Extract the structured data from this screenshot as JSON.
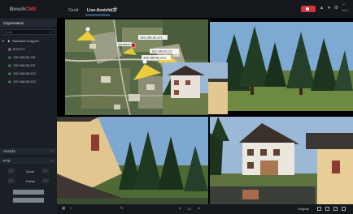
{
  "app": {
    "logo_part1": "Bosch",
    "logo_part2": "CMS",
    "logo_superscript": "®"
  },
  "tabs": [
    {
      "label": "Gerät"
    },
    {
      "label": "Live-Ansicht(1)"
    }
  ],
  "tab_add": "+",
  "clock": "12:3",
  "sidebar": {
    "title": "Organisation",
    "search_placeholder": "Suche",
    "tree": {
      "root_label": "Standard Gruppen",
      "items": [
        {
          "label": "IPCCTV",
          "icon": "group-icon"
        },
        {
          "label": "192.168.62.131",
          "icon": "camera-icon"
        },
        {
          "label": "192.168.62.221",
          "icon": "camera-icon"
        },
        {
          "label": "192.168.62.222",
          "icon": "camera-icon"
        },
        {
          "label": "192.168.62.223",
          "icon": "camera-icon"
        }
      ]
    },
    "sections": [
      {
        "label": "Ansicht"
      },
      {
        "label": "PTZ"
      }
    ],
    "ptz": {
      "zoom_label": "Zoom",
      "focus_label": "Fokus",
      "iris_label": "Iris"
    }
  },
  "map": {
    "labels": [
      "192.168.62.221",
      "192.168.62.131",
      "192.168.62.22",
      "192.168.62.223"
    ]
  },
  "bottombar": {
    "page_label": "1/1",
    "mode_label": "Original"
  },
  "colors": {
    "accent": "#5fa6e2",
    "record": "#d8323a",
    "camera_online": "#52c266",
    "fov_yellow": "#f4d23a"
  }
}
